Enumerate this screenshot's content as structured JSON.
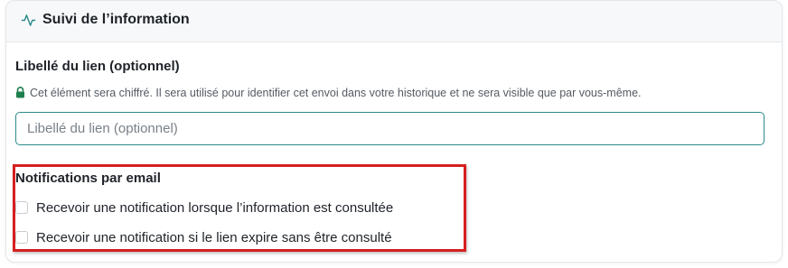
{
  "section": {
    "title": "Suivi de l’information",
    "icon": "activity-icon",
    "accent_color": "#2a8a8a"
  },
  "link_label": {
    "label": "Libellé du lien (optionnel)",
    "hint": "Cet élément sera chiffré. Il sera utilisé pour identifier cet envoi dans votre historique et ne sera visible que par vous-même.",
    "hint_icon": "lock-icon",
    "input_value": "",
    "input_placeholder": "Libellé du lien (optionnel)"
  },
  "notifications": {
    "title": "Notifications par email",
    "highlight_color": "#d61f1f",
    "options": [
      {
        "label": "Recevoir une notification lorsque l’information est consultée",
        "checked": false
      },
      {
        "label": "Recevoir une notification si le lien expire sans être consulté",
        "checked": false
      }
    ]
  }
}
